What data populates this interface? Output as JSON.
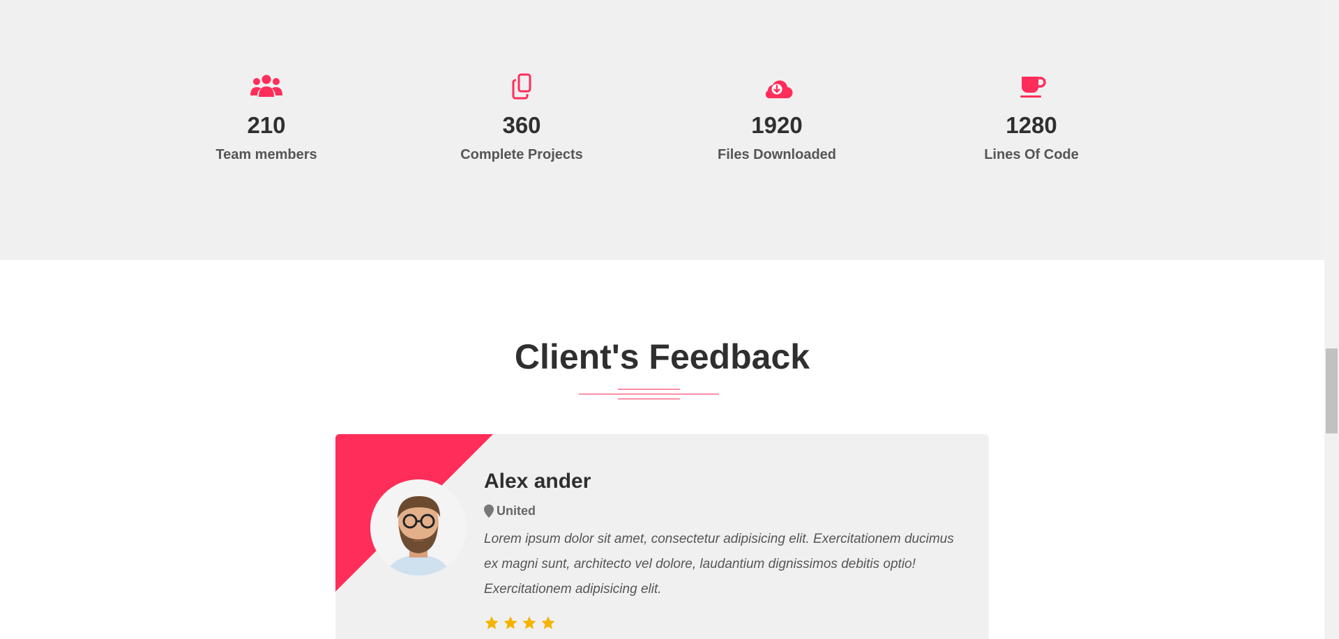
{
  "stats": [
    {
      "icon": "users-icon",
      "value": "210",
      "label": "Team members"
    },
    {
      "icon": "copy-files-icon",
      "value": "360",
      "label": "Complete Projects"
    },
    {
      "icon": "cloud-download-icon",
      "value": "1920",
      "label": "Files Downloaded"
    },
    {
      "icon": "coffee-cup-icon",
      "value": "1280",
      "label": "Lines Of Code"
    }
  ],
  "feedback": {
    "title": "Client's Feedback",
    "card": {
      "name": "Alex ander",
      "location": "United",
      "quote": "Lorem ipsum dolor sit amet, consectetur adipisicing elit. Exercitationem ducimus ex magni sunt, architecto vel dolore, laudantium dignissimos debitis optio! Exercitationem adipisicing elit.",
      "rating": 4
    }
  },
  "colors": {
    "accent": "#ff2d5a",
    "star": "#f5b400",
    "section_bg": "#f0f0f0",
    "heading": "#2f2f2f"
  }
}
